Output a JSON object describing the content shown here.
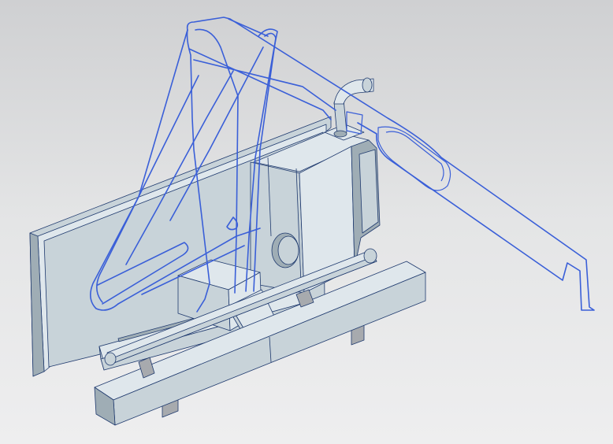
{
  "viewport": {
    "background_top": "#cfd0d2",
    "background_bottom": "#eeeeef"
  },
  "model": {
    "face_color": "#c8d3d9",
    "face_dark": "#9fadb5",
    "face_light": "#dfe7ec",
    "edge_color": "#1f3a6e",
    "wire_color": "#3a5fd8",
    "gray_color": "#a7aaae",
    "gray_dark": "#7f8387"
  }
}
